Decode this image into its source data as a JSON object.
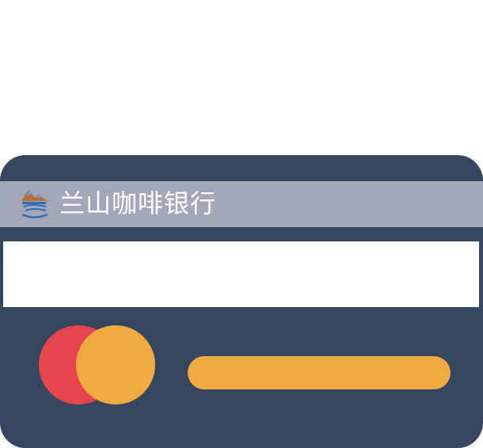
{
  "card": {
    "bank_name": "兰山咖啡银行",
    "logo_icon": "mountain-coffee-cup-icon",
    "colors": {
      "card_body": "#36465e",
      "bank_band": "#a2a7ba",
      "bank_name_text": "#ffffff",
      "signature_strip": "#ffffff",
      "circle_red": "#e5454d",
      "circle_yellow": "#efab42",
      "number_bar": "#efab42"
    }
  }
}
